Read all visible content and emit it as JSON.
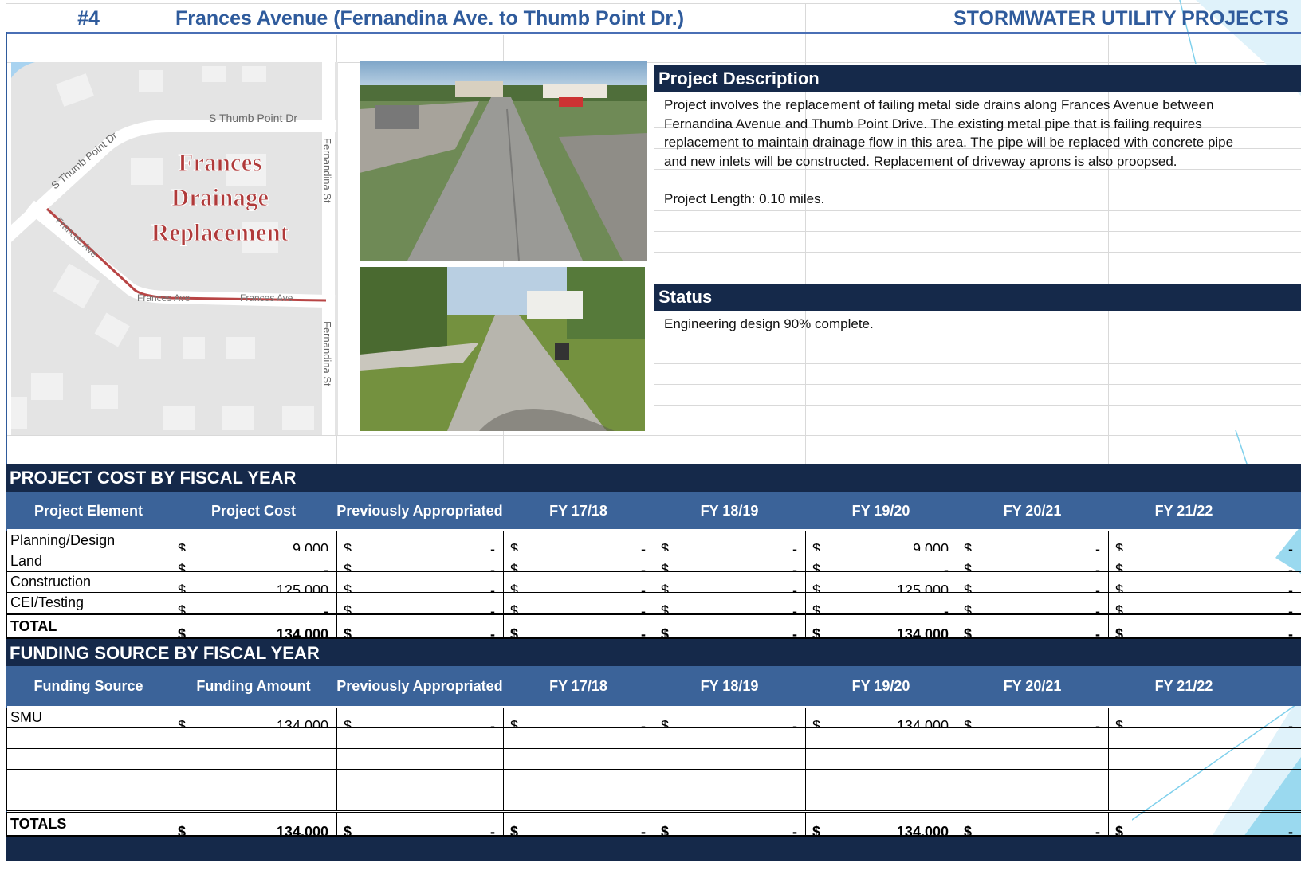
{
  "title": {
    "number": "#4",
    "name": "Frances Avenue (Fernandina Ave. to Thumb Point Dr.)",
    "program": "STORMWATER UTILITY PROJECTS"
  },
  "map": {
    "label_line1": "Frances",
    "label_line2": "Drainage",
    "label_line3": "Replacement",
    "street_thumb_point_1": "S Thumb Point Dr",
    "street_thumb_point_2": "S Thumb Point Dr",
    "street_fernandina_1": "Fernandina St",
    "street_fernandina_2": "Fernandina St",
    "street_frances_1": "Frances Ave",
    "street_frances_2": "Frances Ave",
    "street_frances_3": "Frances Ave"
  },
  "description": {
    "heading": "Project Description",
    "text": "Project involves the replacement of failing metal side drains along Frances Avenue between Fernandina Avenue and Thumb Point Drive.  The existing metal pipe that is failing requires replacement to maintain drainage flow in this area.  The pipe will be replaced with concrete pipe and new inlets will be constructed.  Replacement of driveway aprons is also proopsed.",
    "length": "Project Length:  0.10 miles."
  },
  "status": {
    "heading": "Status",
    "text": "Engineering design 90% complete."
  },
  "cost": {
    "heading": "PROJECT COST BY FISCAL YEAR",
    "columns": [
      "Project Element",
      "Project Cost",
      "Previously Appropriated",
      "FY 17/18",
      "FY 18/19",
      "FY 19/20",
      "FY 20/21",
      "FY 21/22"
    ],
    "currency": "$",
    "rows": [
      {
        "label": "Planning/Design",
        "values": [
          "9,000",
          "-",
          "-",
          "-",
          "9,000",
          "-",
          "-"
        ]
      },
      {
        "label": "Land",
        "values": [
          "-",
          "-",
          "-",
          "-",
          "-",
          "-",
          "-"
        ]
      },
      {
        "label": "Construction",
        "values": [
          "125,000",
          "-",
          "-",
          "-",
          "125,000",
          "-",
          "-"
        ]
      },
      {
        "label": "CEI/Testing",
        "values": [
          "-",
          "-",
          "-",
          "-",
          "-",
          "-",
          "-"
        ]
      }
    ],
    "total": {
      "label": "TOTAL",
      "values": [
        "134,000",
        "-",
        "-",
        "-",
        "134,000",
        "-",
        "-"
      ]
    }
  },
  "funding": {
    "heading": "FUNDING SOURCE BY FISCAL YEAR",
    "columns": [
      "Funding Source",
      "Funding Amount",
      "Previously Appropriated",
      "FY 17/18",
      "FY 18/19",
      "FY 19/20",
      "FY 20/21",
      "FY 21/22"
    ],
    "currency": "$",
    "rows": [
      {
        "label": "SMU",
        "values": [
          "134,000",
          "-",
          "-",
          "-",
          "134,000",
          "-",
          "-"
        ]
      }
    ],
    "total": {
      "label": "TOTALS",
      "values": [
        "134,000",
        "-",
        "-",
        "-",
        "134,000",
        "-",
        "-"
      ]
    }
  },
  "colors": {
    "title_blue": "#2f5b9c",
    "navy_band": "#15294a",
    "header_blue": "#3b6399",
    "map_label_red": "#b03a3a"
  }
}
